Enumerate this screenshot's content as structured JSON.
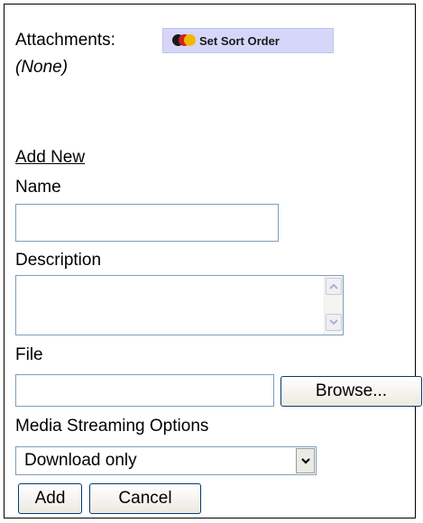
{
  "attachments": {
    "label": "Attachments:",
    "sort_button_label": "Set Sort Order",
    "sort_icon": "colored-dots-icon",
    "none_text": "(None)"
  },
  "add_new": {
    "heading": "Add New",
    "name_label": "Name",
    "name_value": "",
    "description_label": "Description",
    "description_value": "",
    "file_label": "File",
    "file_value": "",
    "browse_label": "Browse...",
    "media_label": "Media Streaming Options",
    "media_selected": "Download only",
    "add_label": "Add",
    "cancel_label": "Cancel"
  },
  "colors": {
    "sort_button_bg": "#d6d6fa",
    "input_border": "#7f9db9",
    "button_border": "#003c74"
  }
}
